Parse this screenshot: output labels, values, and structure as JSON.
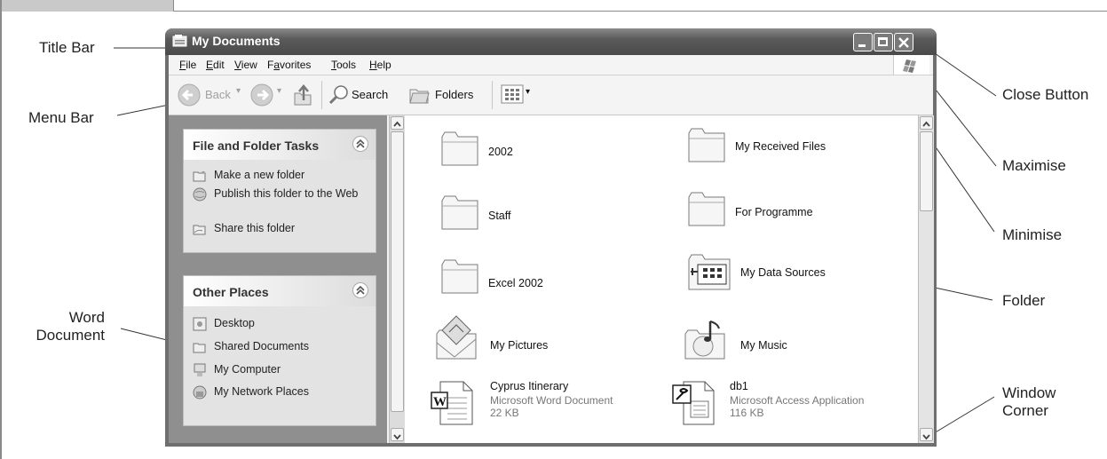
{
  "callouts": {
    "title_bar": "Title Bar",
    "menu_bar": "Menu Bar",
    "word_doc_line1": "Word",
    "word_doc_line2": "Document",
    "close_button": "Close Button",
    "maximise": "Maximise",
    "minimise": "Minimise",
    "folder": "Folder",
    "window_corner_line1": "Window",
    "window_corner_line2": "Corner"
  },
  "window": {
    "title": "My Documents",
    "title_icon": "folder-window-icon"
  },
  "menu": {
    "items": [
      {
        "label": "File",
        "access": "F",
        "rest": "ile"
      },
      {
        "label": "Edit",
        "access": "E",
        "rest": "dit"
      },
      {
        "label": "View",
        "access": "V",
        "rest": "iew"
      },
      {
        "label": "Favorites",
        "pre": "F",
        "access": "a",
        "rest": "vorites"
      },
      {
        "label": "Tools",
        "access": "T",
        "rest": "ools"
      },
      {
        "label": "Help",
        "access": "H",
        "rest": "elp"
      }
    ]
  },
  "toolbar": {
    "back": "Back",
    "search": "Search",
    "folders": "Folders"
  },
  "tasks": {
    "file_folder": {
      "title": "File and Folder Tasks",
      "items": [
        "Make a new folder",
        "Publish this folder to the Web",
        "Share this folder"
      ]
    },
    "other_places": {
      "title": "Other Places",
      "items": [
        "Desktop",
        "Shared Documents",
        "My Computer",
        "My Network Places"
      ]
    }
  },
  "files": [
    {
      "name": "2002",
      "type": "folder"
    },
    {
      "name": "My Received Files",
      "type": "folder"
    },
    {
      "name": "Staff",
      "type": "folder"
    },
    {
      "name": "For Programme",
      "type": "folder"
    },
    {
      "name": "Excel 2002",
      "type": "folder"
    },
    {
      "name": "My Data Sources",
      "type": "data-sources-folder"
    },
    {
      "name": "My Pictures",
      "type": "pictures-folder"
    },
    {
      "name": "My Music",
      "type": "music-folder"
    },
    {
      "name": "Cyprus Itinerary",
      "kind": "Microsoft Word Document",
      "size": "22 KB",
      "type": "word-document"
    },
    {
      "name": "db1",
      "kind": "Microsoft Access Application",
      "size": "116 KB",
      "type": "access-database"
    }
  ]
}
